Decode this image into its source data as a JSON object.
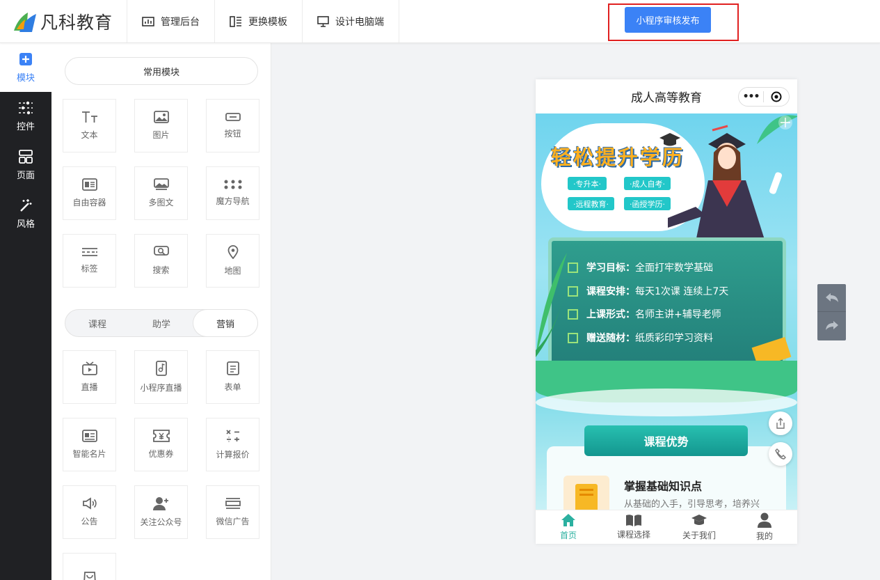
{
  "brand": {
    "name": "凡科教育"
  },
  "topnav": [
    {
      "label": "管理后台",
      "icon": "dashboard-icon"
    },
    {
      "label": "更换模板",
      "icon": "template-icon"
    },
    {
      "label": "设计电脑端",
      "icon": "monitor-icon"
    }
  ],
  "publish_label": "小程序审核发布",
  "sidebar": [
    {
      "label": "模块",
      "icon": "plus-square-icon",
      "active": true
    },
    {
      "label": "控件",
      "icon": "sliders-icon"
    },
    {
      "label": "页面",
      "icon": "page-icon"
    },
    {
      "label": "风格",
      "icon": "magic-wand-icon"
    }
  ],
  "panel": {
    "common_label": "常用模块",
    "common": [
      {
        "label": "文本",
        "icon": "text-icon"
      },
      {
        "label": "图片",
        "icon": "image-icon"
      },
      {
        "label": "按钮",
        "icon": "button-icon"
      },
      {
        "label": "自由容器",
        "icon": "container-icon"
      },
      {
        "label": "多图文",
        "icon": "multi-image-icon"
      },
      {
        "label": "魔方导航",
        "icon": "grid-dots-icon"
      },
      {
        "label": "标签",
        "icon": "tag-icon"
      },
      {
        "label": "搜索",
        "icon": "search-icon"
      },
      {
        "label": "地图",
        "icon": "map-pin-icon"
      }
    ],
    "tabs": [
      "课程",
      "助学",
      "营销"
    ],
    "active_tab": 2,
    "marketing": [
      {
        "label": "直播",
        "icon": "tv-icon"
      },
      {
        "label": "小程序直播",
        "icon": "phone-live-icon"
      },
      {
        "label": "表单",
        "icon": "form-icon"
      },
      {
        "label": "智能名片",
        "icon": "card-icon"
      },
      {
        "label": "优惠券",
        "icon": "coupon-icon"
      },
      {
        "label": "计算报价",
        "icon": "calculator-icon"
      },
      {
        "label": "公告",
        "icon": "speaker-icon"
      },
      {
        "label": "关注公众号",
        "icon": "user-plus-icon"
      },
      {
        "label": "微信广告",
        "icon": "ad-icon"
      },
      {
        "label": "",
        "icon": "bag-icon"
      }
    ]
  },
  "phone": {
    "title": "成人高等教育",
    "capsule_dots": "•••",
    "banner": {
      "headline": "轻松提升学历",
      "chips": [
        "·专升本·",
        "·成人自考·",
        "·远程教育·",
        "·函授学历·"
      ],
      "board": [
        {
          "key": "学习目标：",
          "value": "全面打牢数学基础"
        },
        {
          "key": "课程安排：",
          "value": "每天1次课 连续上7天"
        },
        {
          "key": "上课形式：",
          "value": "名师主讲+辅导老师"
        },
        {
          "key": "赠送随材：",
          "value": "纸质彩印学习资料"
        }
      ]
    },
    "section_title": "课程优势",
    "card": {
      "title": "掌握基础知识点",
      "desc": "从基础的入手，引导思考，培养兴"
    },
    "tabbar": [
      {
        "label": "首页",
        "icon": "home-icon"
      },
      {
        "label": "课程选择",
        "icon": "book-icon"
      },
      {
        "label": "关于我们",
        "icon": "grad-cap-icon"
      },
      {
        "label": "我的",
        "icon": "person-icon"
      }
    ]
  },
  "colors": {
    "accent": "#3b82f6",
    "sidebar": "#202124",
    "teal": "#2bb0a0",
    "highlight_border": "#e02020"
  }
}
